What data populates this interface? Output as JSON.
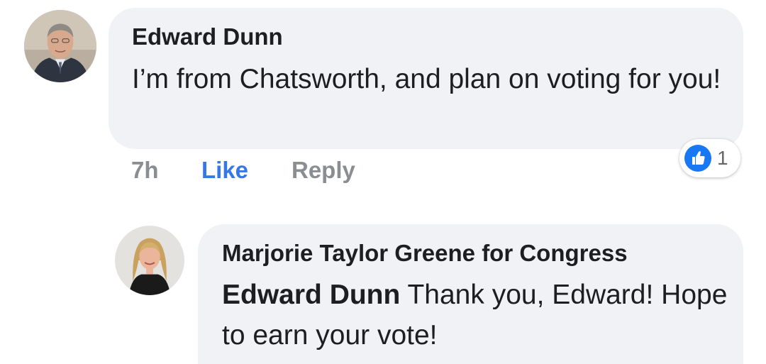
{
  "comment": {
    "author": "Edward Dunn",
    "text": "I’m from Chatsworth, and plan on voting for you!",
    "time": "7h",
    "like_label": "Like",
    "reply_label": "Reply",
    "reaction_count": "1",
    "reaction_icon": "thumbs-up-icon"
  },
  "reply": {
    "author": "Marjorie Taylor Greene for Congress",
    "mention": "Edward Dunn",
    "text": " Thank you, Edward! Hope to earn your vote!"
  },
  "colors": {
    "bubble": "#f0f2f5",
    "link_blue": "#3578e5",
    "meta_gray": "#8a8d91",
    "reaction_blue": "#1877f2"
  }
}
